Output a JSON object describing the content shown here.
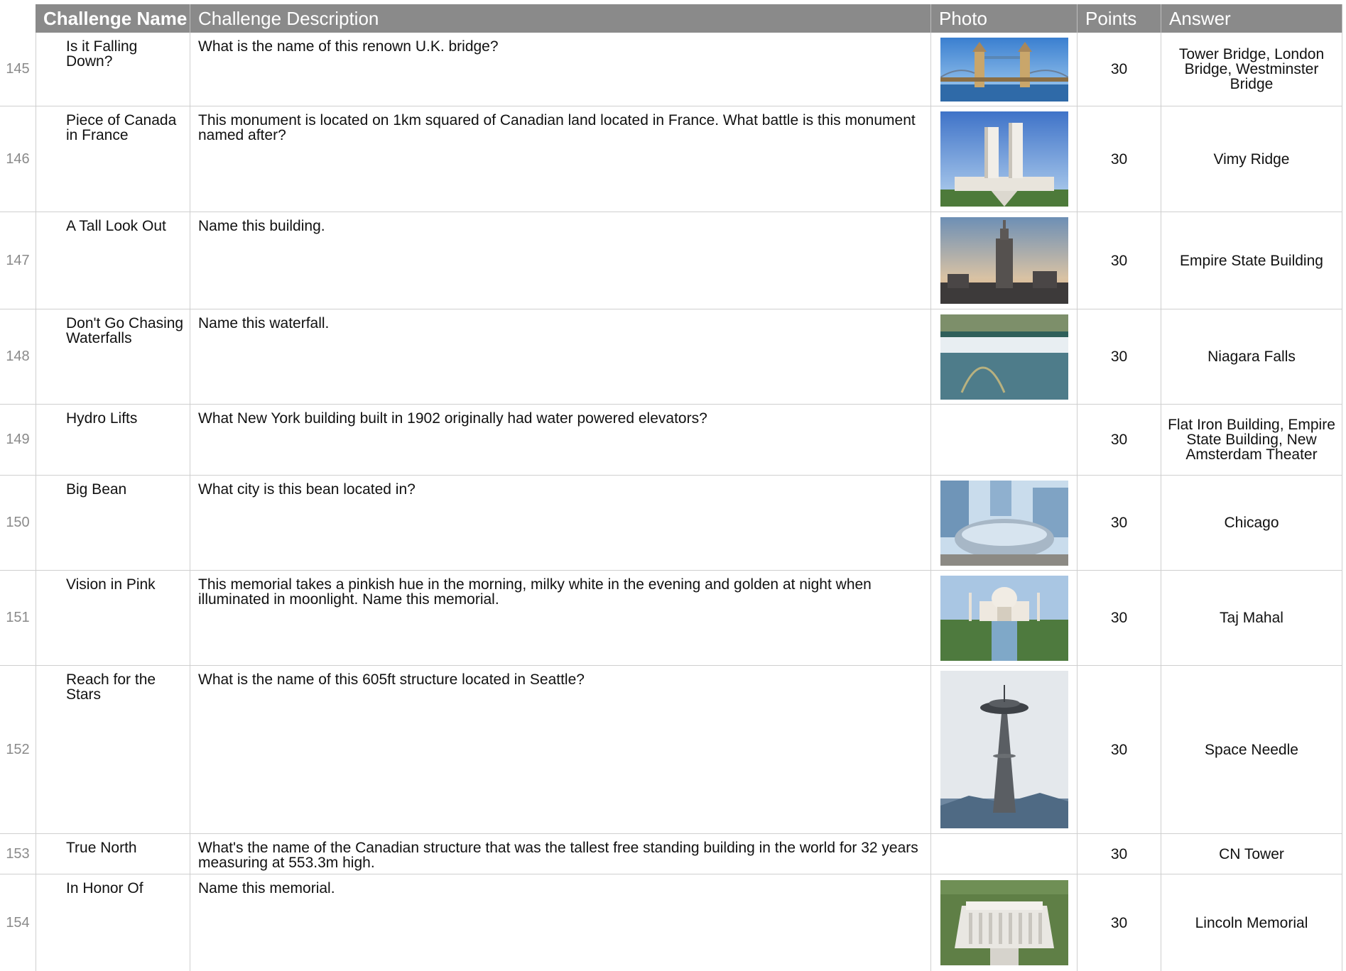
{
  "headers": {
    "name": "Challenge Name",
    "description": "Challenge Description",
    "photo": "Photo",
    "points": "Points",
    "answer": "Answer"
  },
  "rows": [
    {
      "num": "145",
      "name": "Is it Falling Down?",
      "description": "What is the name of this renown U.K. bridge?",
      "photo": "tower-bridge-photo",
      "points": "30",
      "answer": "Tower Bridge, London Bridge, Westminster Bridge"
    },
    {
      "num": "146",
      "name": "Piece of Canada in France",
      "description": "This monument is located on 1km squared of Canadian land located in France. What battle is this monument named after?",
      "photo": "vimy-memorial-photo",
      "points": "30",
      "answer": "Vimy Ridge"
    },
    {
      "num": "147",
      "name": "A Tall Look Out",
      "description": "Name this building.",
      "photo": "empire-state-photo",
      "points": "30",
      "answer": "Empire State Building"
    },
    {
      "num": "148",
      "name": "Don't Go Chasing Waterfalls",
      "description": "Name this waterfall.",
      "photo": "niagara-falls-photo",
      "points": "30",
      "answer": "Niagara Falls"
    },
    {
      "num": "149",
      "name": "Hydro Lifts",
      "description": "What New York building built in 1902 originally had water powered elevators?",
      "photo": "",
      "points": "30",
      "answer": "Flat Iron Building, Empire State Building, New Amsterdam Theater"
    },
    {
      "num": "150",
      "name": "Big Bean",
      "description": "What city is this bean located in?",
      "photo": "cloud-gate-photo",
      "points": "30",
      "answer": "Chicago"
    },
    {
      "num": "151",
      "name": "Vision in Pink",
      "description": "This memorial takes a pinkish hue in the morning, milky white in the evening and golden at night when illuminated in moonlight. Name this memorial.",
      "photo": "taj-mahal-photo",
      "points": "30",
      "answer": "Taj Mahal"
    },
    {
      "num": "152",
      "name": "Reach for the Stars",
      "description": "What is the name of this 605ft structure located in Seattle?",
      "photo": "space-needle-photo",
      "points": "30",
      "answer": "Space Needle"
    },
    {
      "num": "153",
      "name": "True North",
      "description": "What's the name of the Canadian structure that was the tallest free standing building in the world for 32 years measuring at 553.3m high.",
      "photo": "",
      "points": "30",
      "answer": "CN Tower"
    },
    {
      "num": "154",
      "name": "In Honor Of",
      "description": "Name this memorial.",
      "photo": "lincoln-memorial-photo",
      "points": "30",
      "answer": "Lincoln Memorial"
    }
  ],
  "colors": {
    "header_bg": "#8a8a8a",
    "header_text": "#ffffff",
    "row_number": "#8a8a8a",
    "grid_line": "#cfcfcf"
  }
}
